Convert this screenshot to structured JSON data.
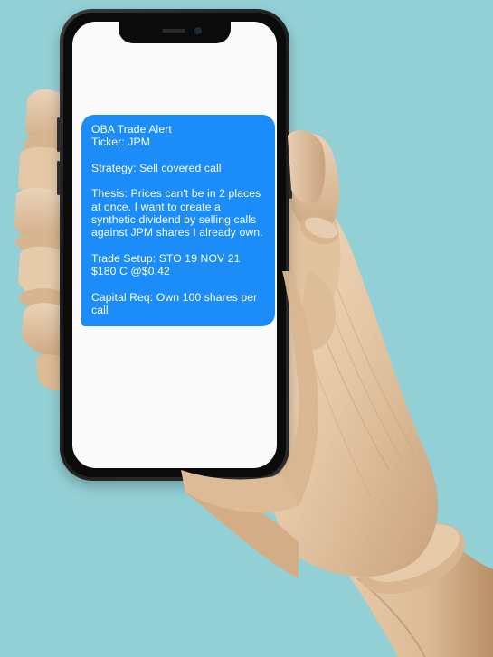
{
  "message": {
    "title": "OBA Trade Alert",
    "ticker": "Ticker: JPM",
    "strategy": "Strategy: Sell covered call",
    "thesis": "Thesis: Prices can't be in 2 places at once. I want to create a synthetic dividend by selling calls against JPM shares I already own.",
    "trade_setup": "Trade Setup: STO 19 NOV 21 $180 C @$0.42",
    "capital_req": "Capital Req: Own 100 shares per call"
  },
  "colors": {
    "background": "#93d0d6",
    "bubble": "#1b8cf8",
    "bubble_text": "#ffffff",
    "screen": "#fafafa"
  }
}
